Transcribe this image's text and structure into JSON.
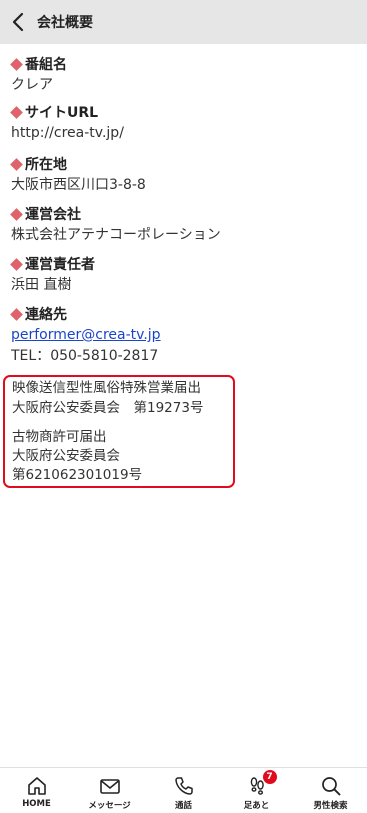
{
  "header": {
    "title": "会社概要"
  },
  "sections": [
    {
      "label": "番組名",
      "values": [
        "クレア"
      ]
    },
    {
      "label": "サイトURL",
      "values": [
        "http://crea-tv.jp/"
      ]
    },
    {
      "label": "所在地",
      "values": [
        "大阪市西区川口3-8-8"
      ]
    },
    {
      "label": "運営会社",
      "values": [
        "株式会社アテナコーポレーション"
      ]
    },
    {
      "label": "運営責任者",
      "values": [
        "浜田 直樹"
      ]
    },
    {
      "label": "連絡先",
      "email": "performer@crea-tv.jp",
      "tel": "TEL：050-5810-2817"
    }
  ],
  "notice": {
    "lines": [
      "映像送信型性風俗特殊営業届出",
      "大阪府公安委員会　第19273号",
      "古物商許可届出",
      "大阪府公安委員会",
      "第621062301019号"
    ]
  },
  "tabbar": {
    "items": [
      {
        "label": "HOME",
        "icon": "home-icon"
      },
      {
        "label": "メッセージ",
        "icon": "mail-icon"
      },
      {
        "label": "通話",
        "icon": "phone-icon"
      },
      {
        "label": "足あと",
        "icon": "footprint-icon",
        "badge": "7"
      },
      {
        "label": "男性検索",
        "icon": "search-icon"
      }
    ]
  },
  "colors": {
    "accent": "#e0626a",
    "notice_border": "#e00b1c",
    "link": "#1a45c9",
    "header_bg": "#e6e6e6"
  }
}
